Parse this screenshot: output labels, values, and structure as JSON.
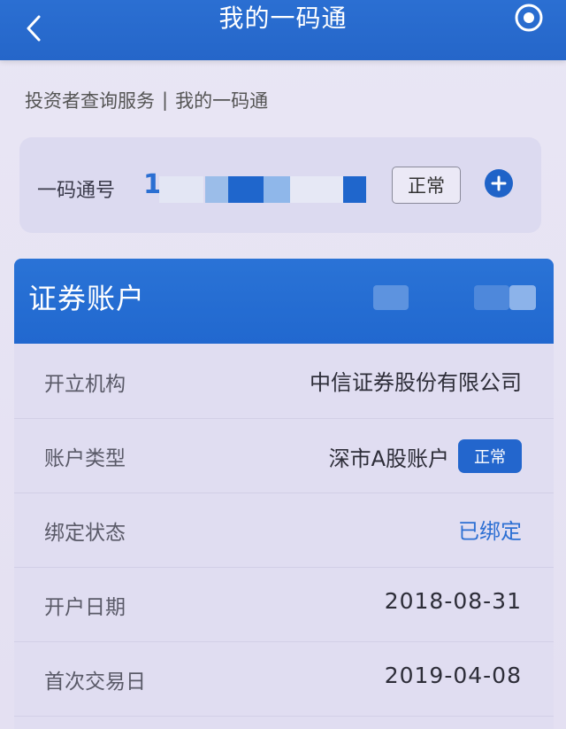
{
  "nav": {
    "title": "我的一码通",
    "back_icon": "chevron-left-icon",
    "action_icon": "target-icon"
  },
  "breadcrumb": {
    "parent": "投资者查询服务",
    "separator": "|",
    "current": "我的一码通"
  },
  "id_card": {
    "label": "一码通号",
    "value_visible": "1",
    "status": "正常",
    "add_icon": "plus-circle-icon"
  },
  "account": {
    "title": "证券账户",
    "rows": [
      {
        "label": "开立机构",
        "value": "中信证券股份有限公司"
      },
      {
        "label": "账户类型",
        "value": "深市A股账户",
        "badge": "正常"
      },
      {
        "label": "绑定状态",
        "value": "已绑定"
      },
      {
        "label": "开户日期",
        "value": "2018-08-31"
      },
      {
        "label": "首次交易日",
        "value": "2019-04-08"
      }
    ]
  },
  "colors": {
    "primary": "#2b6fd2",
    "background": "#e6e3f3",
    "card": "#dcdaf0"
  }
}
